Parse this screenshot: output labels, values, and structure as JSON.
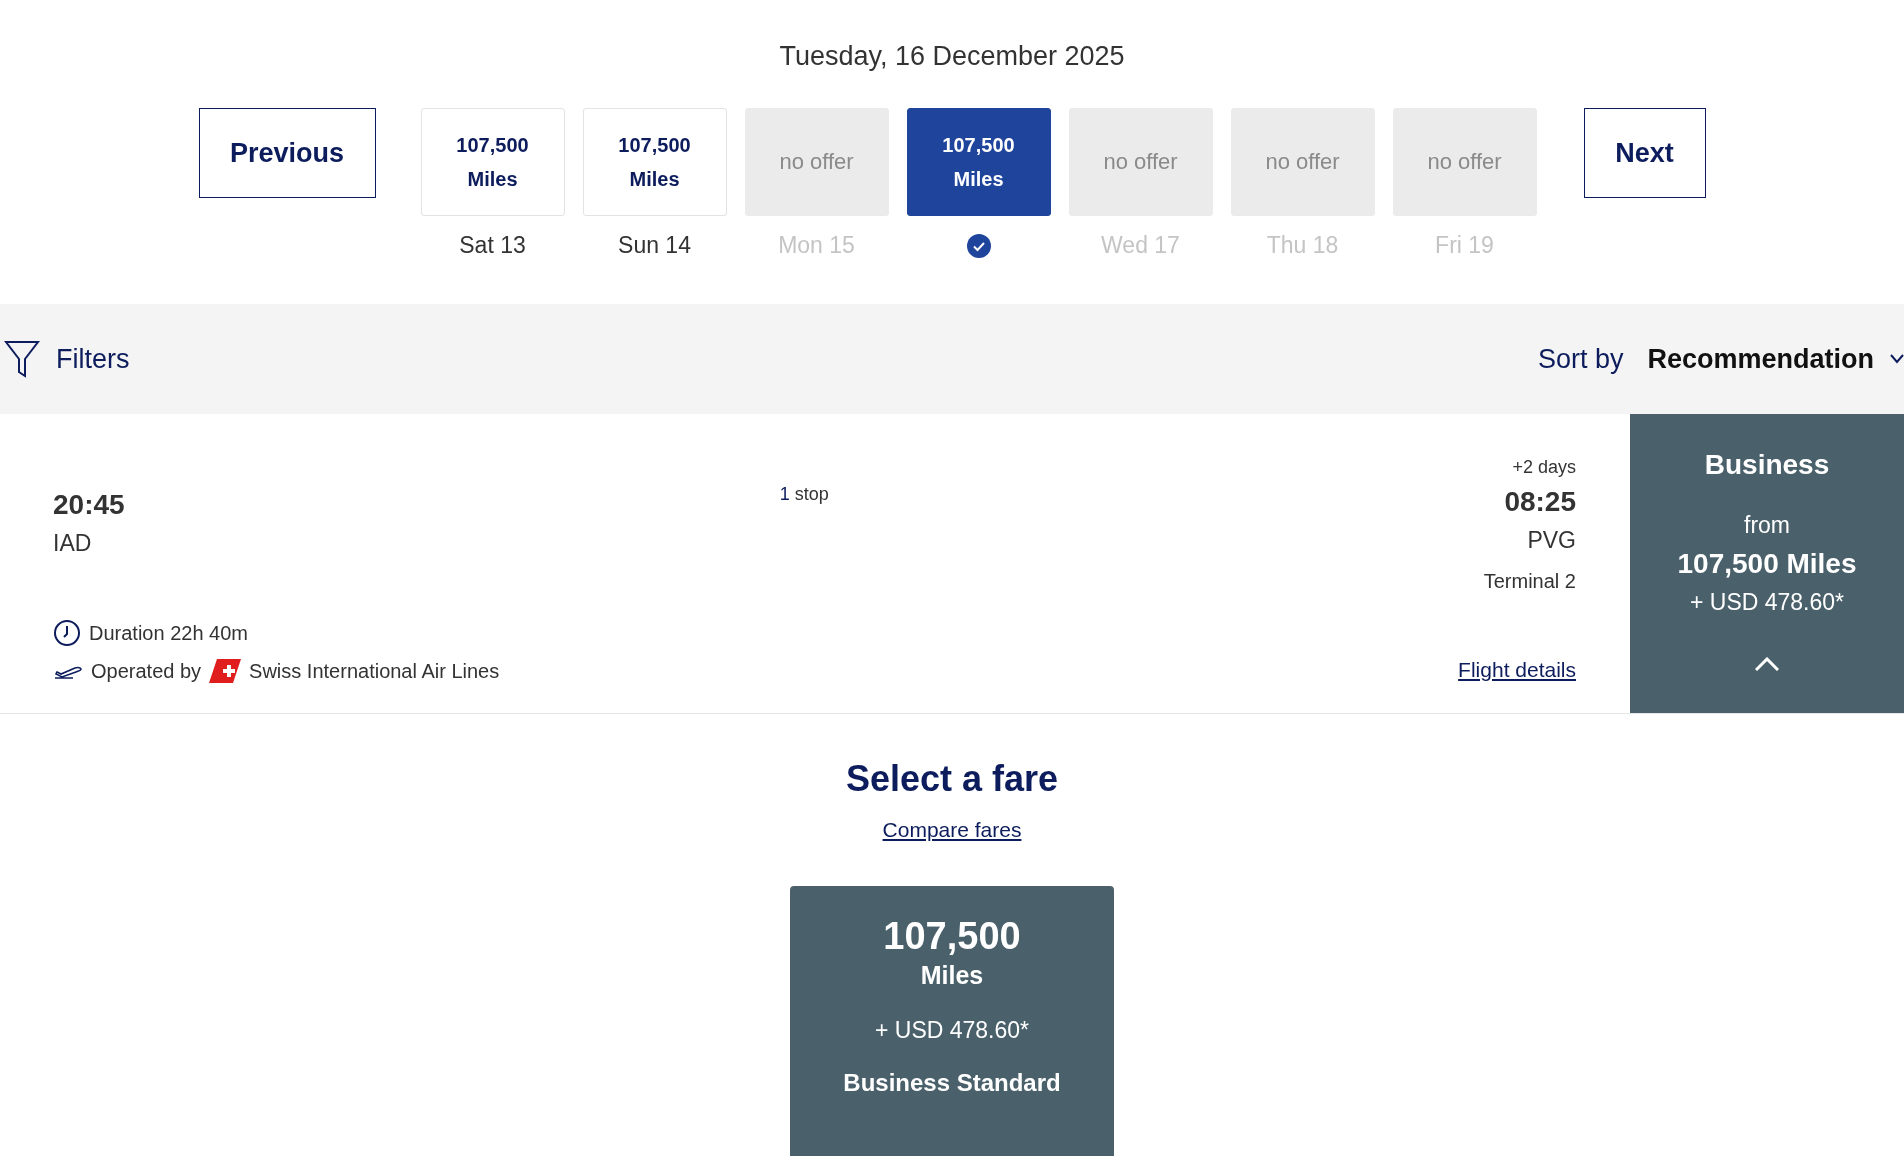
{
  "date_title": "Tuesday, 16 December 2025",
  "date_nav": {
    "previous": "Previous",
    "next": "Next",
    "days": [
      {
        "lines": [
          "107,500",
          "Miles"
        ],
        "day": "Sat 13",
        "available": true,
        "selected": false
      },
      {
        "lines": [
          "107,500",
          "Miles"
        ],
        "day": "Sun 14",
        "available": true,
        "selected": false
      },
      {
        "lines": [
          "no offer"
        ],
        "day": "Mon 15",
        "available": false,
        "selected": false
      },
      {
        "lines": [
          "107,500",
          "Miles"
        ],
        "available": true,
        "selected": true
      },
      {
        "lines": [
          "no offer"
        ],
        "day": "Wed 17",
        "available": false,
        "selected": false
      },
      {
        "lines": [
          "no offer"
        ],
        "day": "Thu 18",
        "available": false,
        "selected": false
      },
      {
        "lines": [
          "no offer"
        ],
        "day": "Fri 19",
        "available": false,
        "selected": false
      }
    ]
  },
  "toolbar": {
    "filters": "Filters",
    "sort_label": "Sort by",
    "sort_value": "Recommendation"
  },
  "flight": {
    "departure_time": "20:45",
    "departure_airport": "IAD",
    "stops_count": "1",
    "stops_label": "stop",
    "arrival_offset": "+2 days",
    "arrival_time": "08:25",
    "arrival_airport": "PVG",
    "arrival_terminal": "Terminal 2",
    "duration": "Duration 22h 40m",
    "operated_by": "Operated by",
    "airline": "Swiss International Air Lines",
    "details_link": "Flight details",
    "cabin": {
      "name": "Business",
      "from": "from",
      "miles": "107,500 Miles",
      "cash": "+ USD 478.60*",
      "expanded": true
    }
  },
  "fare_section": {
    "title": "Select a fare",
    "compare_link": "Compare fares",
    "fares": [
      {
        "miles": "107,500",
        "unit": "Miles",
        "cash": "+ USD 478.60*",
        "name": "Business Standard"
      }
    ]
  }
}
